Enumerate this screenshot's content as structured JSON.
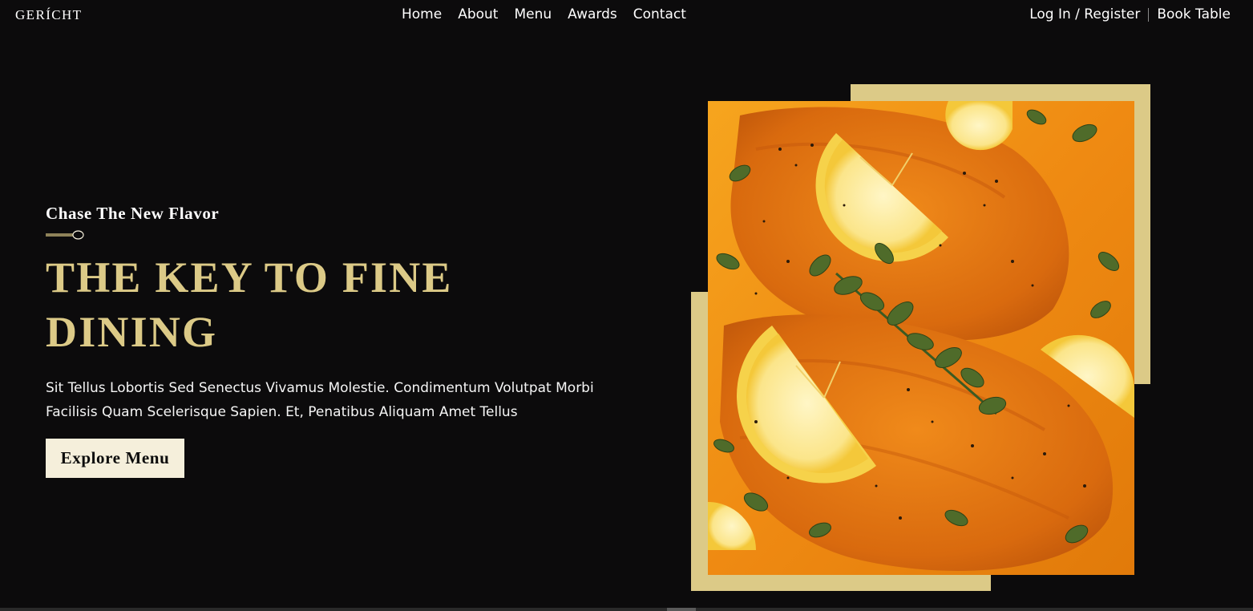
{
  "brand": {
    "logo": "GERÍCHT"
  },
  "nav": {
    "links": [
      "Home",
      "About",
      "Menu",
      "Awards",
      "Contact"
    ],
    "login": "Log In / Register",
    "book": "Book Table"
  },
  "hero": {
    "subtitle": "Chase The New Flavor",
    "headline": "THE KEY TO FINE DINING",
    "description": "Sit Tellus Lobortis Sed Senectus Vivamus Molestie. Condimentum Volutpat Morbi Facilisis Quam Scelerisque Sapien. Et, Penatibus Aliquam Amet Tellus",
    "cta": "Explore Menu"
  },
  "colors": {
    "background": "#0c0b0c",
    "accent_gold": "#dcca87",
    "button_bg": "#f5efdb",
    "text": "#ffffff"
  },
  "icons": {
    "divider": "spoon-icon"
  }
}
